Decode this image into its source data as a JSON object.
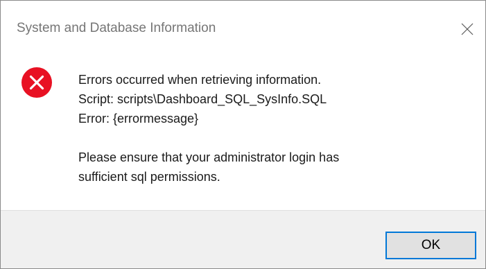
{
  "window": {
    "title": "System and Database Information"
  },
  "icons": {
    "close": "close-icon",
    "error": "error-icon"
  },
  "colors": {
    "error_icon": "#e81123",
    "button_border": "#0078d7",
    "footer_bg": "#f0f0f0",
    "title_text": "#767676"
  },
  "message": {
    "line1": "Errors occurred when retrieving information.",
    "line2": "Script: scripts\\Dashboard_SQL_SysInfo.SQL",
    "line3": "Error: {errormessage}",
    "line4": "Please ensure that your administrator login has",
    "line5": "sufficient sql permissions."
  },
  "buttons": {
    "ok_label": "OK"
  }
}
